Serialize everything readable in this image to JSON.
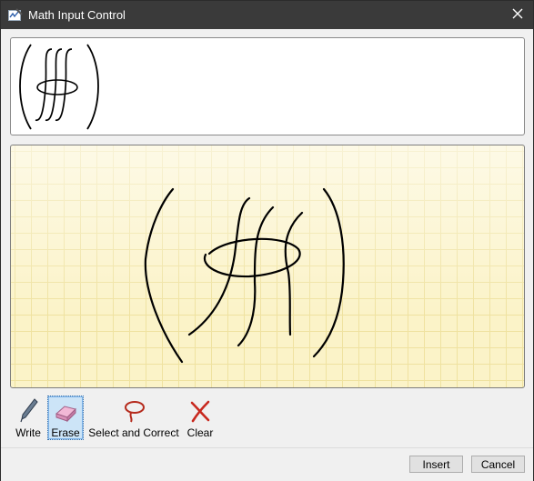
{
  "window": {
    "title": "Math Input Control",
    "close_glyph": "✕"
  },
  "preview": {
    "expression": "( ∯ ∫ ∫ )"
  },
  "toolbar": {
    "write_label": "Write",
    "erase_label": "Erase",
    "select_correct_label": "Select and Correct",
    "clear_label": "Clear",
    "active_tool": "erase"
  },
  "buttons": {
    "insert_label": "Insert",
    "cancel_label": "Cancel"
  },
  "colors": {
    "titlebar": "#3a3a3a",
    "canvas": "#fbf3c8",
    "grid": "#efe2a0",
    "ink": "#000000",
    "active_tool": "#cce4f7"
  }
}
